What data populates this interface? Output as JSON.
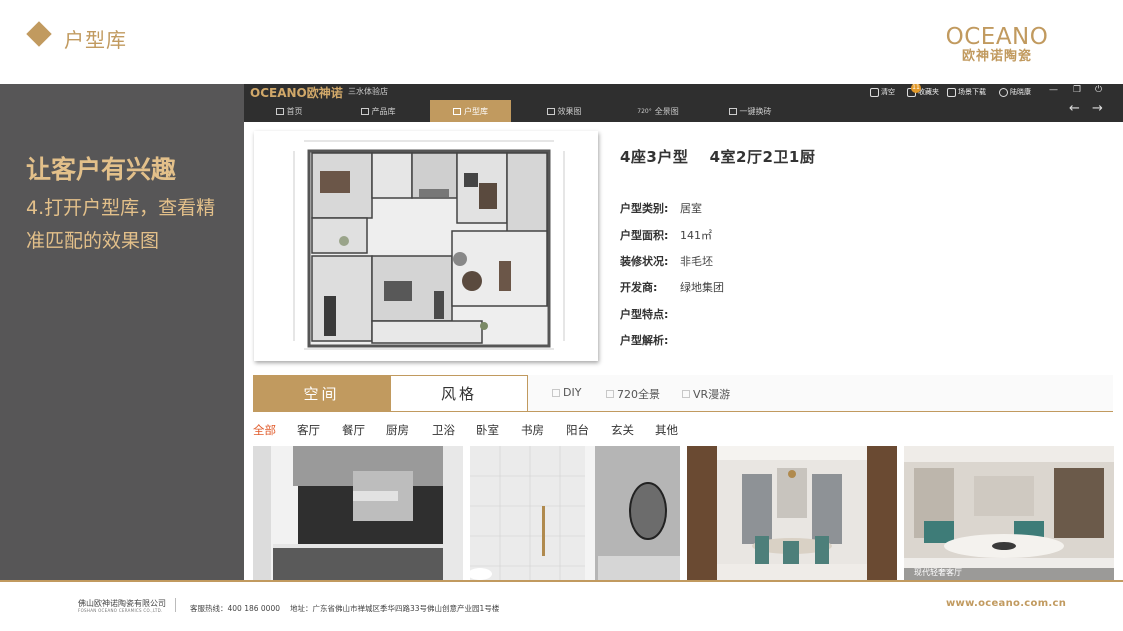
{
  "slide": {
    "title": "户型库",
    "logo_en": "OCEANO",
    "logo_cn": "欧神诺陶瓷",
    "accent_color": "#c19a5f"
  },
  "left_panel": {
    "heading": "让客户有兴趣",
    "subtext": "4.打开户型库，查看精准匹配的效果图"
  },
  "app": {
    "logo": "OCEANO欧神诺",
    "store": "三水体验店",
    "toolbar": {
      "clear": "清空",
      "cart": "收藏夹",
      "cart_badge": "11",
      "download": "场景下载",
      "user": "陆晓康"
    },
    "nav": [
      {
        "label": "首页",
        "icon": "home-icon"
      },
      {
        "label": "产品库",
        "icon": "grid-icon"
      },
      {
        "label": "户型库",
        "icon": "floorplan-icon"
      },
      {
        "label": "效果图",
        "icon": "image-icon"
      },
      {
        "label": "全景图",
        "icon": "panorama-720-icon"
      },
      {
        "label": "一键换砖",
        "icon": "brush-icon"
      }
    ],
    "active_nav": "户型库",
    "plan": {
      "title": "4座3户型　 4室2厅2卫1厨",
      "fields": [
        {
          "label": "户型类别:",
          "value": "居室"
        },
        {
          "label": "户型面积:",
          "value": "141㎡"
        },
        {
          "label": "装修状况:",
          "value": "非毛坯"
        },
        {
          "label": "开发商:",
          "value": "绿地集团"
        },
        {
          "label": "户型特点:",
          "value": ""
        },
        {
          "label": "户型解析:",
          "value": ""
        }
      ]
    },
    "tabs": {
      "space": "空间",
      "style": "风格"
    },
    "filters": [
      "DIY",
      "720全景",
      "VR漫游"
    ],
    "categories": [
      "全部",
      "客厅",
      "餐厅",
      "厨房",
      "卫浴",
      "卧室",
      "书房",
      "阳台",
      "玄关",
      "其他"
    ],
    "active_category": "全部",
    "thumbnails": [
      {
        "caption": "",
        "scene": "kitchen"
      },
      {
        "caption": "",
        "scene": "bathroom"
      },
      {
        "caption": "",
        "scene": "dining"
      },
      {
        "caption": "现代轻奢客厅",
        "scene": "living"
      }
    ]
  },
  "footer": {
    "company": "佛山欧神诺陶瓷有限公司",
    "company_en": "FOSHAN OCEANO CERAMICS CO.,LTD.",
    "phone": "客服热线：400 186 0000",
    "address": "地址：广东省佛山市禅城区季华四路33号佛山创意产业园1号楼",
    "website": "www.oceano.com.cn"
  }
}
